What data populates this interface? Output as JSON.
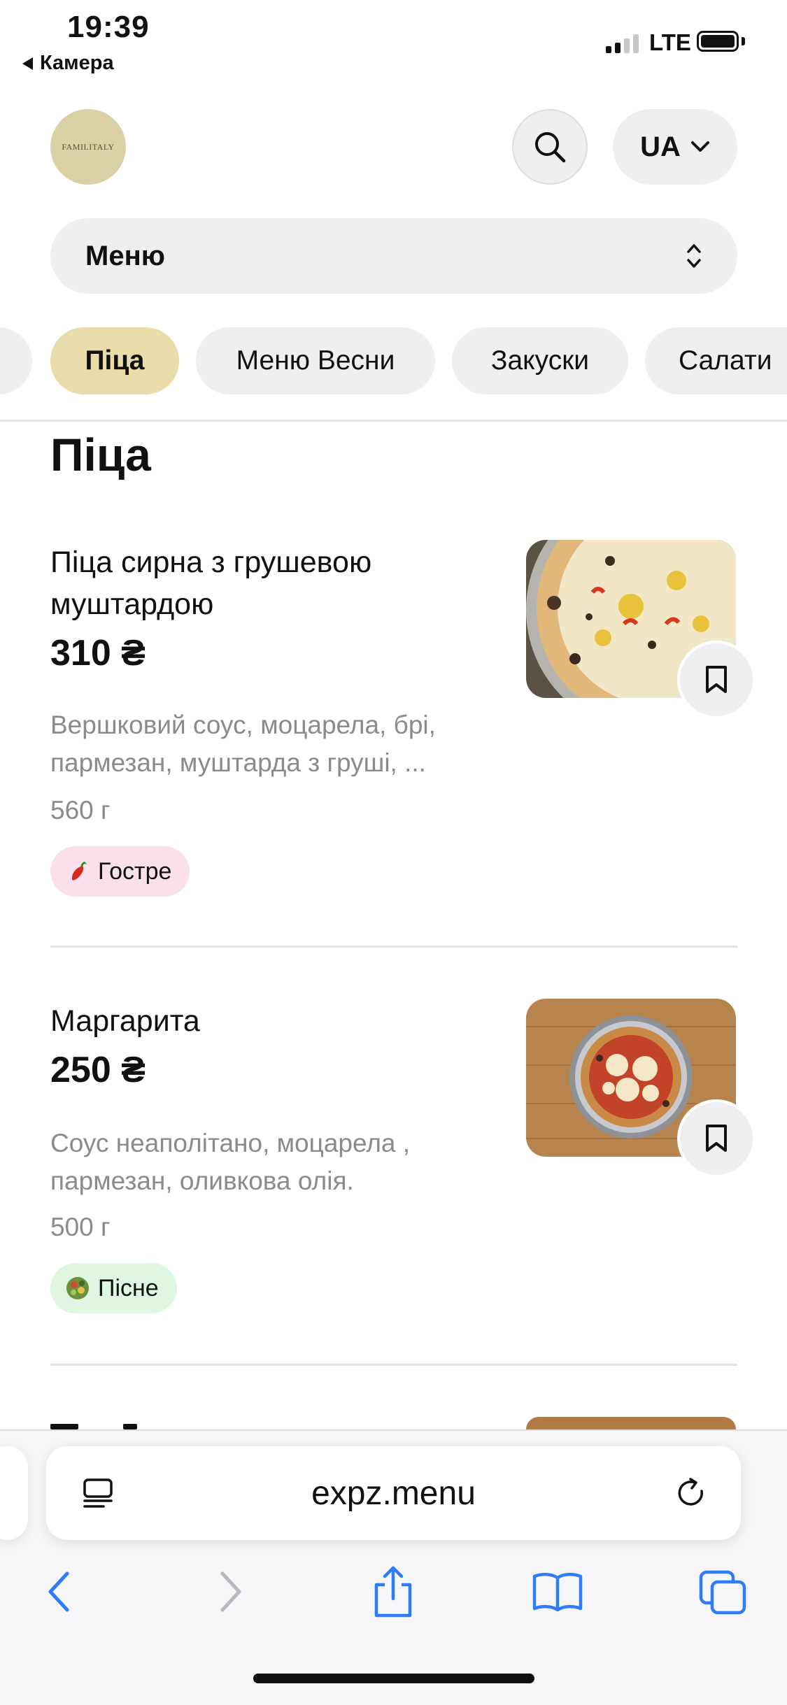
{
  "status_bar": {
    "time": "19:39",
    "back_app": "Камера",
    "network": "LTE"
  },
  "header": {
    "logo_text": "FAMILITALY",
    "language": "UA"
  },
  "menu_select": {
    "label": "Меню"
  },
  "categories": [
    "Піца",
    "Меню Весни",
    "Закуски",
    "Салати"
  ],
  "section": {
    "title": "Піца"
  },
  "items": [
    {
      "name": "Піца сирна з грушевою муштардою",
      "price": "310 ₴",
      "description": "Вершковий соус, моцарела, брі, пармезан, муштарда з груші, ...",
      "weight": "560 г",
      "tag": "Гостре"
    },
    {
      "name": "Маргарита",
      "price": "250 ₴",
      "description": "Соус неаполітано, моцарела , пармезан, оливкова олія.",
      "weight": "500 г",
      "tag": "Пісне"
    }
  ],
  "browser": {
    "url": "expz.menu"
  },
  "colors": {
    "accent_chip": "#e8dcaa",
    "spicy_tag": "#fbe0ea",
    "lent_tag": "#dff7e2",
    "safari_blue": "#2f7cf6"
  }
}
